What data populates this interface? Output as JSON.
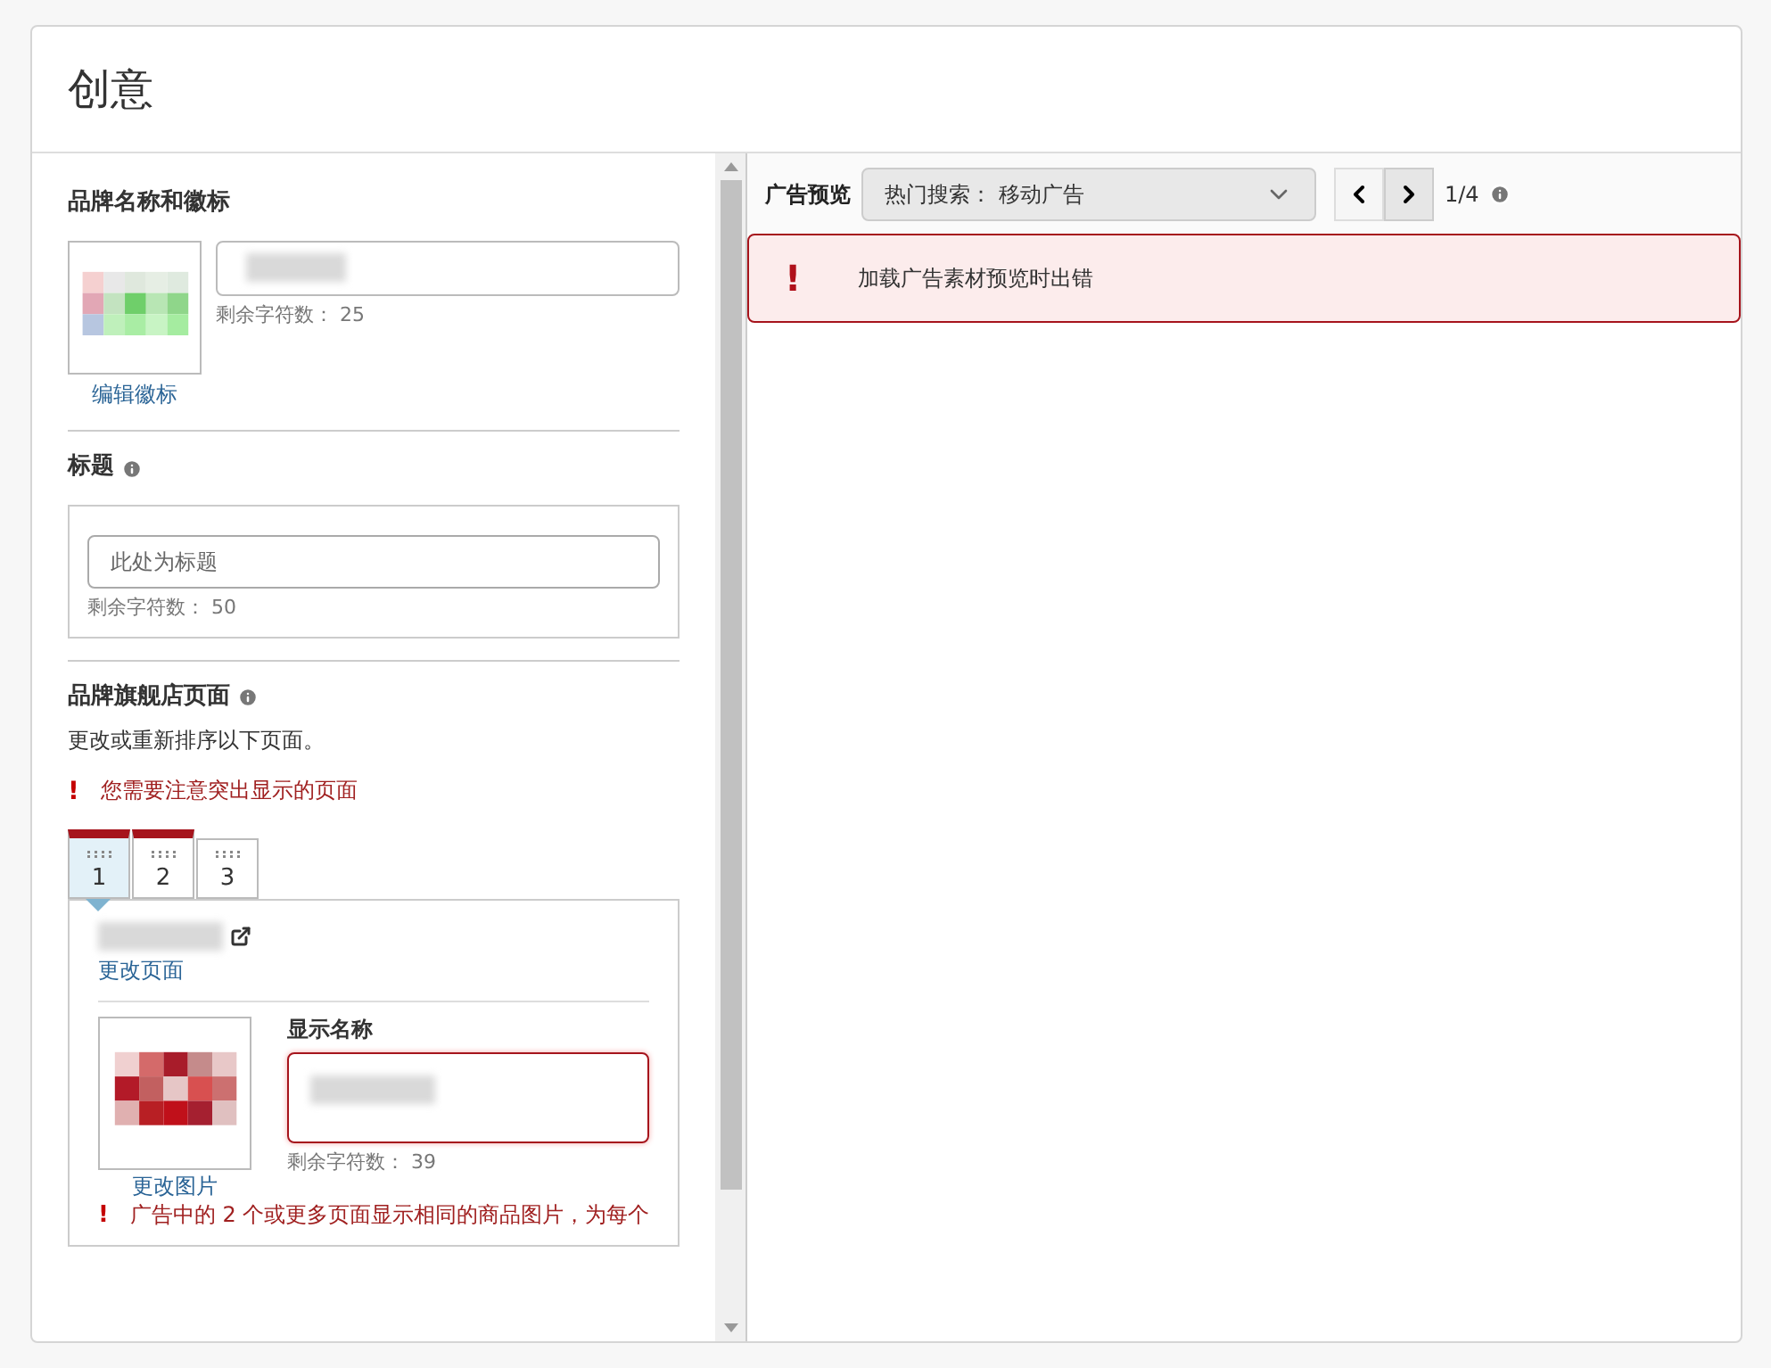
{
  "page": {
    "title": "创意"
  },
  "brand": {
    "heading": "品牌名称和徽标",
    "edit_logo_link": "编辑徽标",
    "remaining": "剩余字符数： 25"
  },
  "headline": {
    "heading": "标题",
    "placeholder": "此处为标题",
    "remaining": "剩余字符数： 50"
  },
  "store": {
    "heading": "品牌旗舰店页面",
    "description": "更改或重新排序以下页面。",
    "warning_icon": "!",
    "warning": "您需要注意突出显示的页面",
    "tabs": [
      {
        "label": "1",
        "selected": true,
        "flagged": true
      },
      {
        "label": "2",
        "selected": false,
        "flagged": true
      },
      {
        "label": "3",
        "selected": false,
        "flagged": false
      }
    ],
    "change_page_link": "更改页面",
    "change_image_link": "更改图片",
    "display_name_label": "显示名称",
    "display_name_error": true,
    "remaining": "剩余字符数： 39",
    "bottom_warning_icon": "!",
    "bottom_warning": "广告中的 2 个或更多页面显示相同的商品图片，为每个"
  },
  "preview": {
    "label": "广告预览",
    "select_value": "热门搜索： 移动广告",
    "counter": "1/4",
    "error_icon": "!",
    "error": "加载广告素材预览时出错"
  }
}
